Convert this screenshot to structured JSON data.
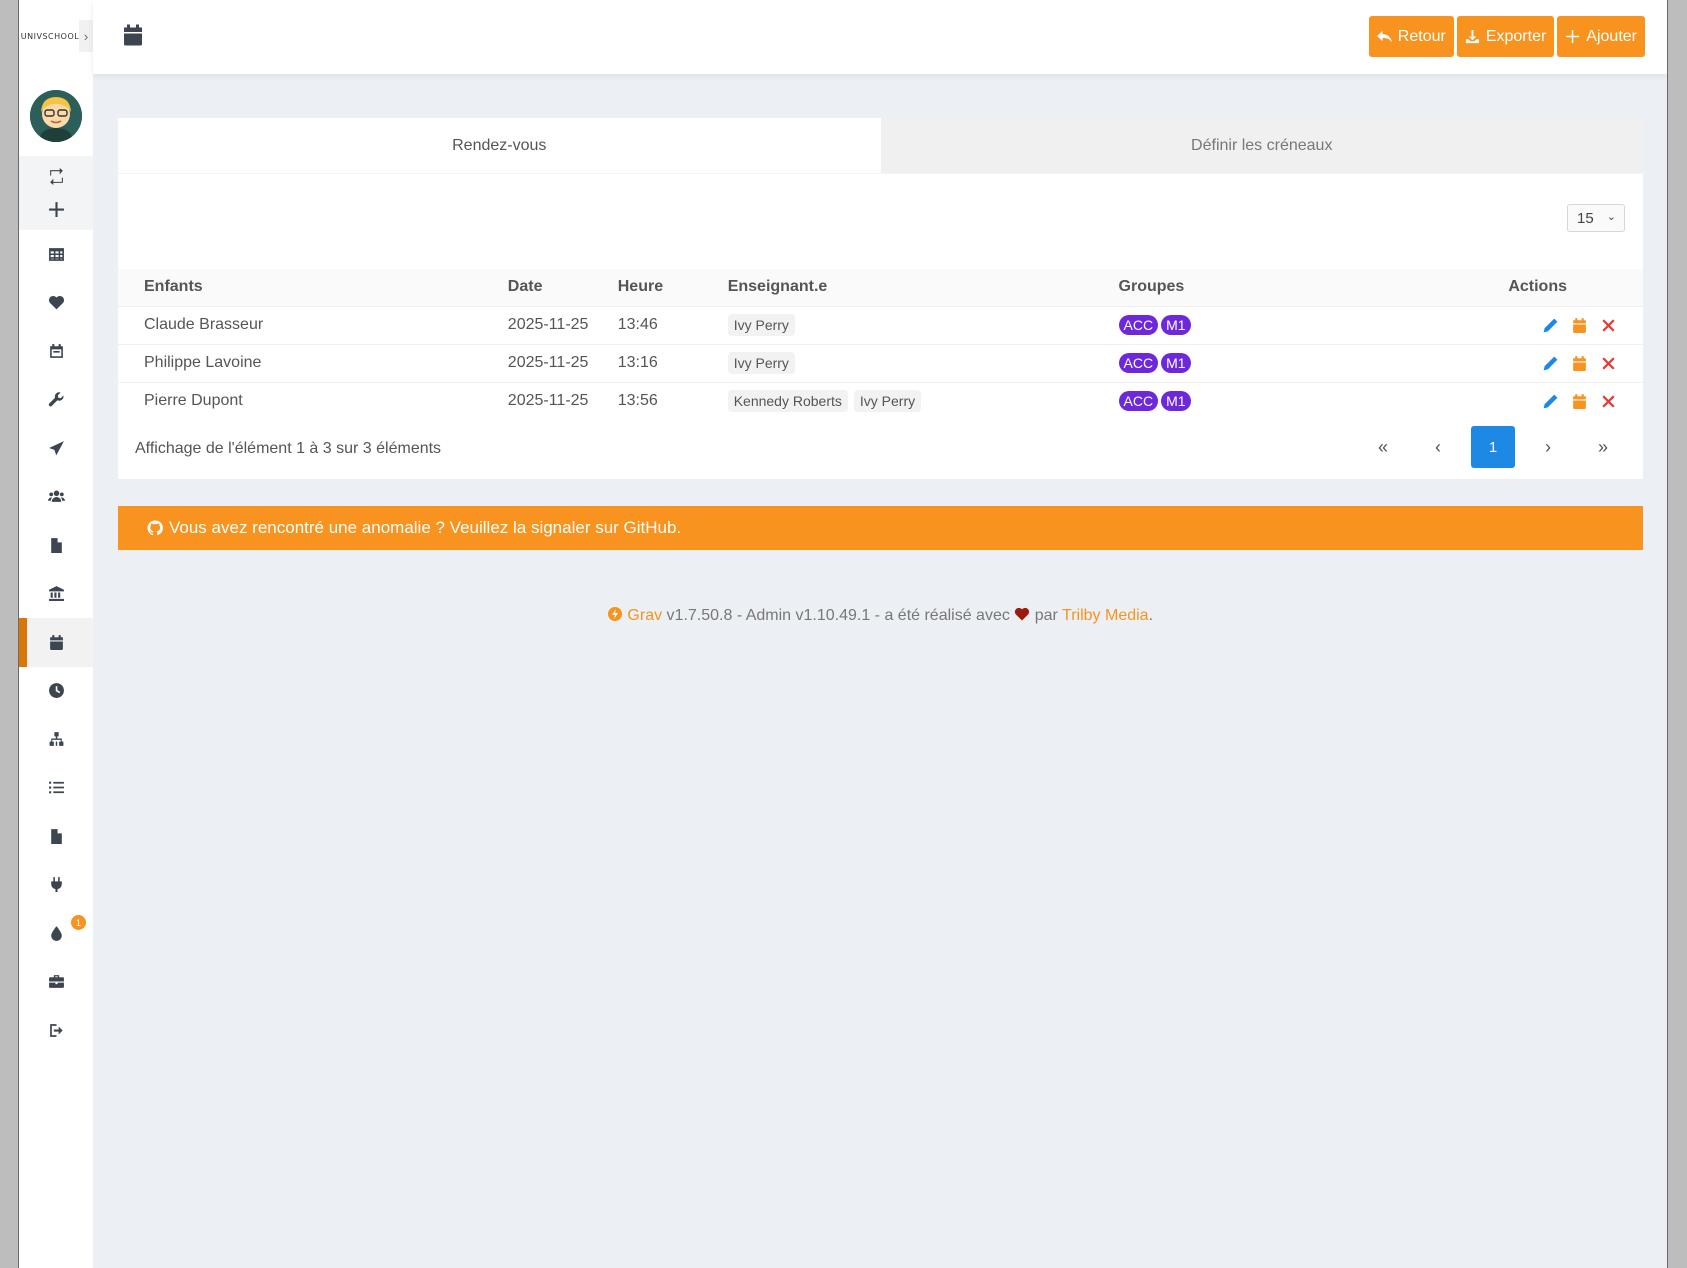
{
  "brand": {
    "logo_text": "UNIVSCHOOL"
  },
  "header": {
    "buttons": {
      "back": "Retour",
      "export": "Exporter",
      "add": "Ajouter"
    }
  },
  "tabs": [
    {
      "label": "Rendez-vous",
      "active": true
    },
    {
      "label": "Définir les créneaux",
      "active": false
    }
  ],
  "table": {
    "per_page": "15",
    "headers": {
      "child": "Enfants",
      "date": "Date",
      "time": "Heure",
      "teacher": "Enseignant.e",
      "groups": "Groupes",
      "actions": "Actions"
    },
    "rows": [
      {
        "child": "Claude Brasseur",
        "date": "2025-11-25",
        "time": "13:46",
        "teachers": [
          "Ivy Perry"
        ],
        "groups": [
          "ACC",
          "M1"
        ]
      },
      {
        "child": "Philippe Lavoine",
        "date": "2025-11-25",
        "time": "13:16",
        "teachers": [
          "Ivy Perry"
        ],
        "groups": [
          "ACC",
          "M1"
        ]
      },
      {
        "child": "Pierre Dupont",
        "date": "2025-11-25",
        "time": "13:56",
        "teachers": [
          "Kennedy Roberts",
          "Ivy Perry"
        ],
        "groups": [
          "ACC",
          "M1"
        ]
      }
    ]
  },
  "pagination": {
    "info": "Affichage de l'élément 1 à 3 sur 3 éléments",
    "current": "1",
    "first": "«",
    "prev": "‹",
    "next": "›",
    "last": "»"
  },
  "notice": {
    "text": "Vous avez rencontré une anomalie ? Veuillez la signaler sur GitHub."
  },
  "footer": {
    "grav": "Grav",
    "version": " v1.7.50.8 - Admin v1.10.49.1 - a été réalisé avec ",
    "par": " par ",
    "trilby": "Trilby Media",
    "dot": "."
  },
  "sidebar": {
    "notifications_badge": "1"
  },
  "colors": {
    "accent": "#f7931e",
    "active_marker": "#d97706",
    "group_badge": "#6d28d9",
    "current_page": "#1e88e5",
    "edit": "#1e88e5",
    "delete": "#e53935"
  }
}
